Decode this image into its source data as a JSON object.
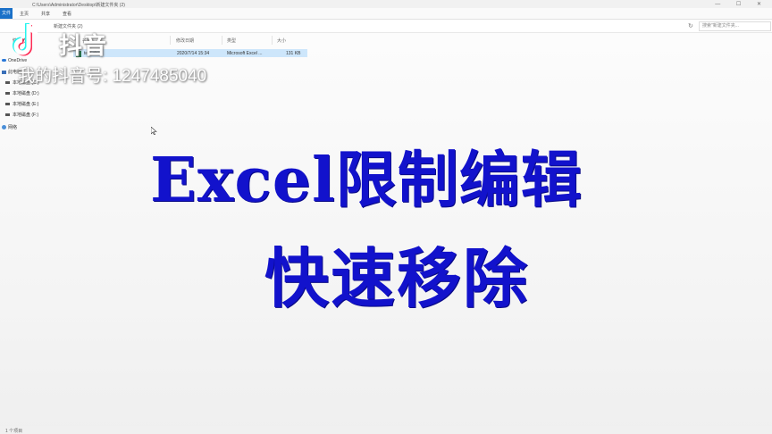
{
  "window": {
    "path": "C:\\Users\\Administrator\\Desktop\\新建文件夹 (2)",
    "controls": "— ☐ ✕"
  },
  "ribbon": {
    "tabs": [
      "文件",
      "主页",
      "共享",
      "查看"
    ]
  },
  "address": {
    "crumb": "新建文件夹 (2)",
    "search_placeholder": "搜索\"新建文件夹...",
    "refresh_glyph": "↻"
  },
  "nav": {
    "items": [
      "快速访问",
      "OneDrive",
      "此电脑",
      "本地磁盘 (C:)",
      "本地磁盘 (D:)",
      "本地磁盘 (E:)",
      "本地磁盘 (F:)",
      "网络"
    ]
  },
  "columns": {
    "name": "名称",
    "date": "修改日期",
    "type": "类型",
    "size": "大小"
  },
  "files": [
    {
      "name": "test.xlsx",
      "date": "2020/7/14 15:34",
      "type": "Microsoft Excel ...",
      "size": "131 KB"
    }
  ],
  "watermark": {
    "app_name": "抖音",
    "user_id": "我的抖音号: 1247485040"
  },
  "captions": {
    "line1": "Excel限制编辑",
    "line2": "快速移除"
  },
  "status": {
    "text": "1 个项目"
  },
  "colors": {
    "caption": "#1212cc",
    "ribbon_file_tab": "#1a70c8",
    "selection": "#cde6fb"
  }
}
